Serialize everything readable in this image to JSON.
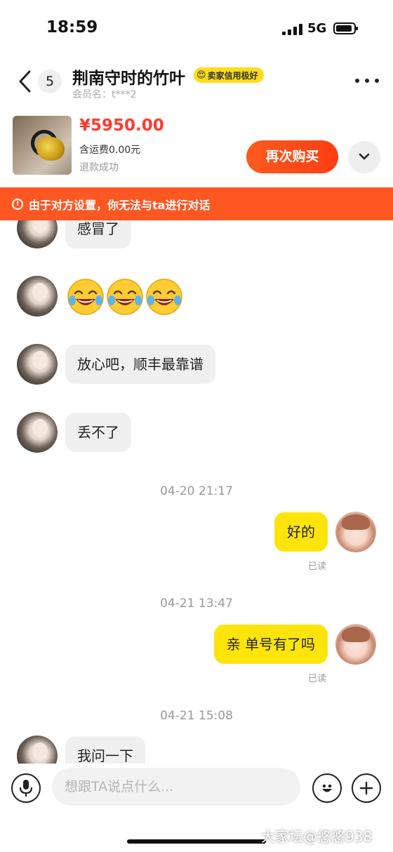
{
  "status_bar": {
    "time": "18:59",
    "network": "5G"
  },
  "header": {
    "unread_count": "5",
    "title": "荆南守时的竹叶",
    "credit_badge": "卖家信用极好",
    "member_name": "会员名：t***2"
  },
  "product": {
    "price": "¥5950.00",
    "shipping": "含运费0.00元",
    "status": "退款成功",
    "buy_again_label": "再次购买"
  },
  "banner": {
    "text": "由于对方设置，你无法与ta进行对话"
  },
  "messages": {
    "m1": "感冒了",
    "m2_emoji_count": 3,
    "m3": "放心吧，顺丰最靠谱",
    "m4": "丢不了",
    "time1": "04-20 21:17",
    "m5": "好的",
    "read1": "已读",
    "time2": "04-21 13:47",
    "m6": "亲 单号有了吗",
    "read2": "已读",
    "time3": "04-21 15:08",
    "m7": "我问一下"
  },
  "input_bar": {
    "placeholder": "想跟TA说点什么..."
  },
  "watermark": "大家坛@悠悠938",
  "colors": {
    "accent_orange": "#ff5722",
    "price_red": "#ff3b30",
    "bubble_yellow": "#ffe40b",
    "badge_yellow": "#ffdd1a"
  },
  "icons": [
    "back-icon",
    "more-icon",
    "chevron-down-icon",
    "warning-icon",
    "laughing-emoji-icon",
    "microphone-icon",
    "emoji-icon",
    "add-icon"
  ]
}
